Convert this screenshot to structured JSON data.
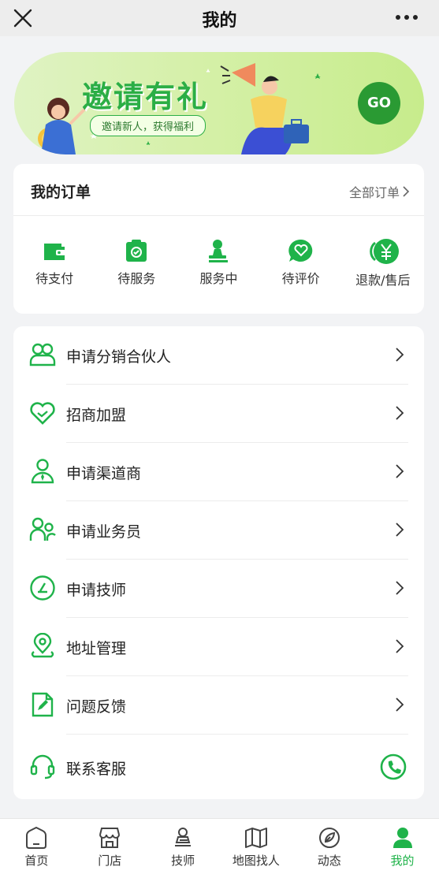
{
  "header": {
    "title": "我的"
  },
  "banner": {
    "title": "邀请有礼",
    "subtitle": "邀请新人，获得福利",
    "go_label": "GO"
  },
  "orders": {
    "title": "我的订单",
    "all_label": "全部订单",
    "items": [
      {
        "label": "待支付",
        "icon": "wallet-icon"
      },
      {
        "label": "待服务",
        "icon": "clipboard-check-icon"
      },
      {
        "label": "服务中",
        "icon": "stamp-icon"
      },
      {
        "label": "待评价",
        "icon": "heart-chat-icon"
      },
      {
        "label": "退款/售后",
        "icon": "yen-refund-icon"
      }
    ]
  },
  "menu": {
    "items": [
      {
        "label": "申请分销合伙人",
        "icon": "partners-icon"
      },
      {
        "label": "招商加盟",
        "icon": "heart-handshake-icon"
      },
      {
        "label": "申请渠道商",
        "icon": "person-tie-icon"
      },
      {
        "label": "申请业务员",
        "icon": "staff-icon"
      },
      {
        "label": "申请技师",
        "icon": "technician-icon"
      },
      {
        "label": "地址管理",
        "icon": "location-pin-icon"
      },
      {
        "label": "问题反馈",
        "icon": "feedback-doc-icon"
      },
      {
        "label": "联系客服",
        "icon": "headset-icon"
      }
    ]
  },
  "tabbar": {
    "items": [
      {
        "label": "首页",
        "icon": "home-icon"
      },
      {
        "label": "门店",
        "icon": "store-icon"
      },
      {
        "label": "技师",
        "icon": "technician-tab-icon"
      },
      {
        "label": "地图找人",
        "icon": "map-icon"
      },
      {
        "label": "动态",
        "icon": "compass-leaf-icon"
      },
      {
        "label": "我的",
        "icon": "user-icon"
      }
    ],
    "active_index": 5
  },
  "colors": {
    "accent": "#1fb34a",
    "banner_green": "#2bae45"
  }
}
